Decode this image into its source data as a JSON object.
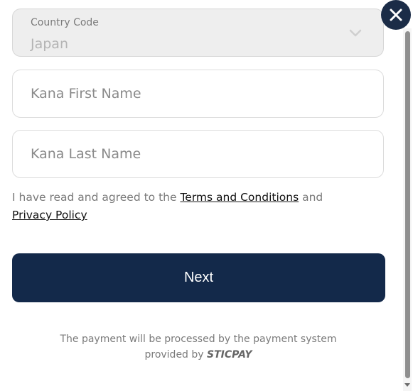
{
  "country_code": {
    "label": "Country Code",
    "value": "Japan"
  },
  "kana_first_name": {
    "placeholder": "Kana First Name",
    "value": ""
  },
  "kana_last_name": {
    "placeholder": "Kana Last Name",
    "value": ""
  },
  "agreement": {
    "prefix": "I have read and agreed to the",
    "terms_link": "Terms and Conditions",
    "conjunction": "and",
    "privacy_link": "Privacy Policy"
  },
  "next_button": {
    "label": "Next"
  },
  "footer": {
    "line1": "The payment will be processed by the payment system",
    "line2_prefix": "provided by",
    "brand": "STICPAY"
  },
  "icons": {
    "close": "close-icon",
    "chevron": "chevron-down-icon"
  },
  "colors": {
    "primary": "#13294a",
    "close_button": "#1b2c47",
    "disabled_bg": "#eeeeee",
    "muted_text": "#7a7a7a"
  }
}
